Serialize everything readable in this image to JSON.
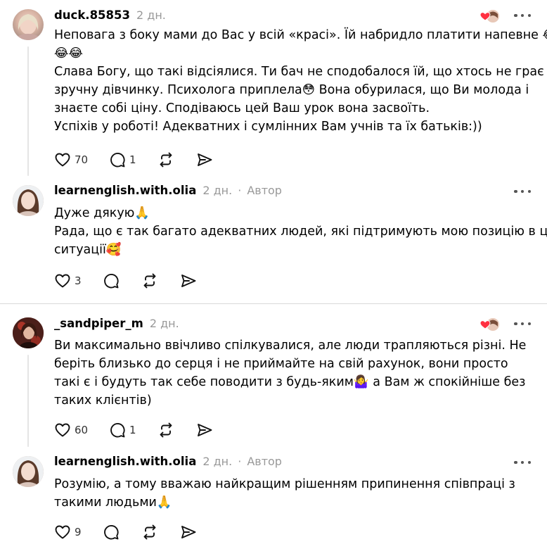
{
  "comments": [
    {
      "username": "duck.85853",
      "time": "2 дн.",
      "lines": [
        "Неповага з боку мами до Вас у всій «красі». Їй набридло платити напевне 😂",
        "😂😂",
        "Слава Богу, що такі відсіялися. Ти бач не сподобалося їй, що хтось не грає в",
        "зручну дівчинку. Психолога приплела😳 Вона обурилася, що Ви молода і",
        "знаєте собі ціну. Сподіваюсь цей Ваш урок вона засвоїть.",
        "Успіхів у роботі! Адекватних і сумлінних Вам учнів та їх батьків:))"
      ],
      "likes": "70",
      "replies": "1"
    },
    {
      "username": "learnenglish.with.olia",
      "time": "2 дн.",
      "author_label": "Автор",
      "lines": [
        "Дуже дякую🙏",
        "Рада, що є так багато адекватних людей, які підтримують мою позицію в цій",
        "ситуації🥰"
      ],
      "likes": "3"
    },
    {
      "username": "_sandpiper_m",
      "time": "2 дн.",
      "lines": [
        "Ви максимально ввічливо спілкувалися, але люди трапляються різні. Не",
        "беріть близько до серця і не приймайте на свій рахунок, вони просто",
        "такі є і будуть так себе поводити з будь-яким🤷‍♀️ а Вам ж спокійніше без",
        "таких клієнтів)"
      ],
      "likes": "60",
      "replies": "1"
    },
    {
      "username": "learnenglish.with.olia",
      "time": "2 дн.",
      "author_label": "Автор",
      "lines": [
        "Розумію, а тому вважаю найкращим рішенням припинення співпраці з",
        "такими людьми🙏"
      ],
      "likes": "9"
    }
  ],
  "separator": "·",
  "colors": {
    "heart_badge": "#ff3040",
    "muted": "#999999",
    "divider": "#d9d9d9"
  }
}
